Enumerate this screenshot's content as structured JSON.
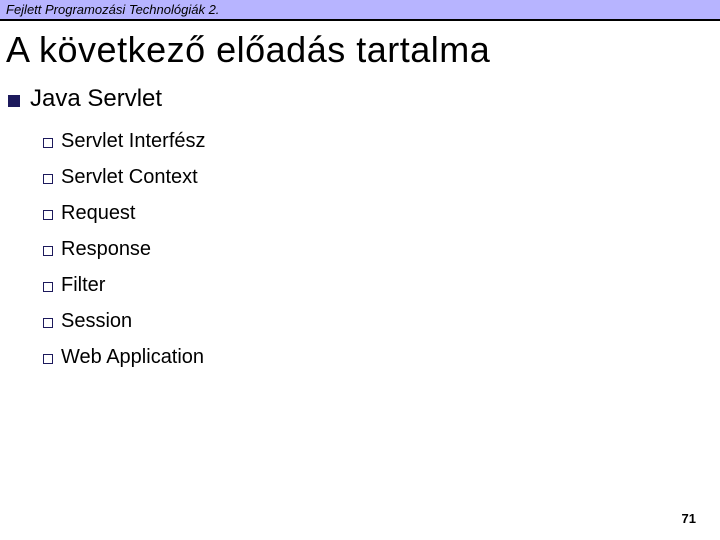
{
  "header": {
    "course": "Fejlett Programozási Technológiák 2."
  },
  "title": "A következő előadás tartalma",
  "main": {
    "topic": "Java Servlet",
    "items": [
      "Servlet Interfész",
      "Servlet Context",
      "Request",
      "Response",
      "Filter",
      "Session",
      "Web Application"
    ]
  },
  "page_number": "71"
}
